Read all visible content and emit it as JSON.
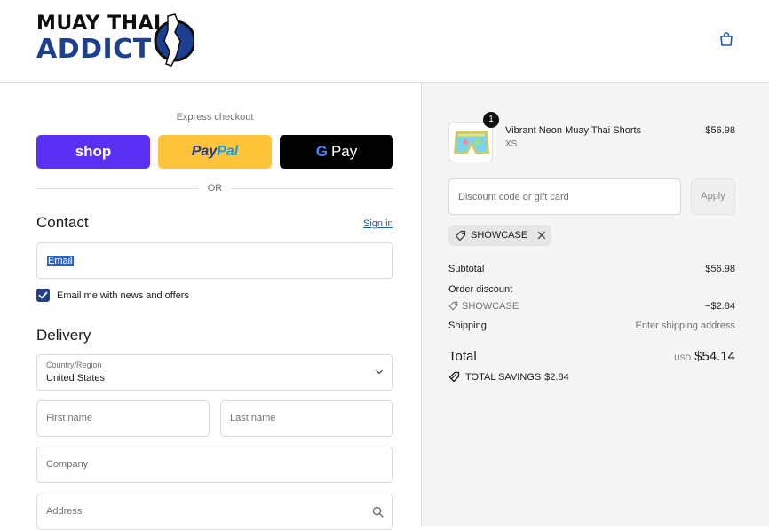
{
  "header": {
    "logo_line1": "MUAY THAI",
    "logo_line2": "ADDICT"
  },
  "checkout": {
    "express_label": "Express checkout",
    "shop_label": "shop",
    "paypal_label_1": "Pay",
    "paypal_label_2": "Pal",
    "gpay_g": "G",
    "gpay_label": "Pay",
    "or_label": "OR"
  },
  "contact": {
    "title": "Contact",
    "signin": "Sign in",
    "email_placeholder": "Email",
    "newsletter_label": "Email me with news and offers",
    "newsletter_checked": true
  },
  "delivery": {
    "title": "Delivery",
    "country_label": "Country/Region",
    "country_value": "United States",
    "first_name_placeholder": "First name",
    "last_name_placeholder": "Last name",
    "company_placeholder": "Company",
    "address_placeholder": "Address"
  },
  "summary": {
    "product_qty": "1",
    "product_name": "Vibrant Neon Muay Thai Shorts",
    "product_variant": "XS",
    "product_price": "$56.98",
    "discount_placeholder": "Discount code or gift card",
    "apply_label": "Apply",
    "applied_code": "SHOWCASE",
    "subtotal_label": "Subtotal",
    "subtotal_value": "$56.98",
    "order_discount_label": "Order discount",
    "discount_code": "SHOWCASE",
    "discount_value": "−$2.84",
    "shipping_label": "Shipping",
    "shipping_value": "Enter shipping address",
    "total_label": "Total",
    "total_currency": "USD",
    "total_value": "$54.14",
    "savings_label": "TOTAL SAVINGS",
    "savings_value": "$2.84"
  },
  "colors": {
    "shop": "#5a31f4",
    "paypal": "#ffc439",
    "gpay": "#000000",
    "accent": "#1f3f86"
  }
}
